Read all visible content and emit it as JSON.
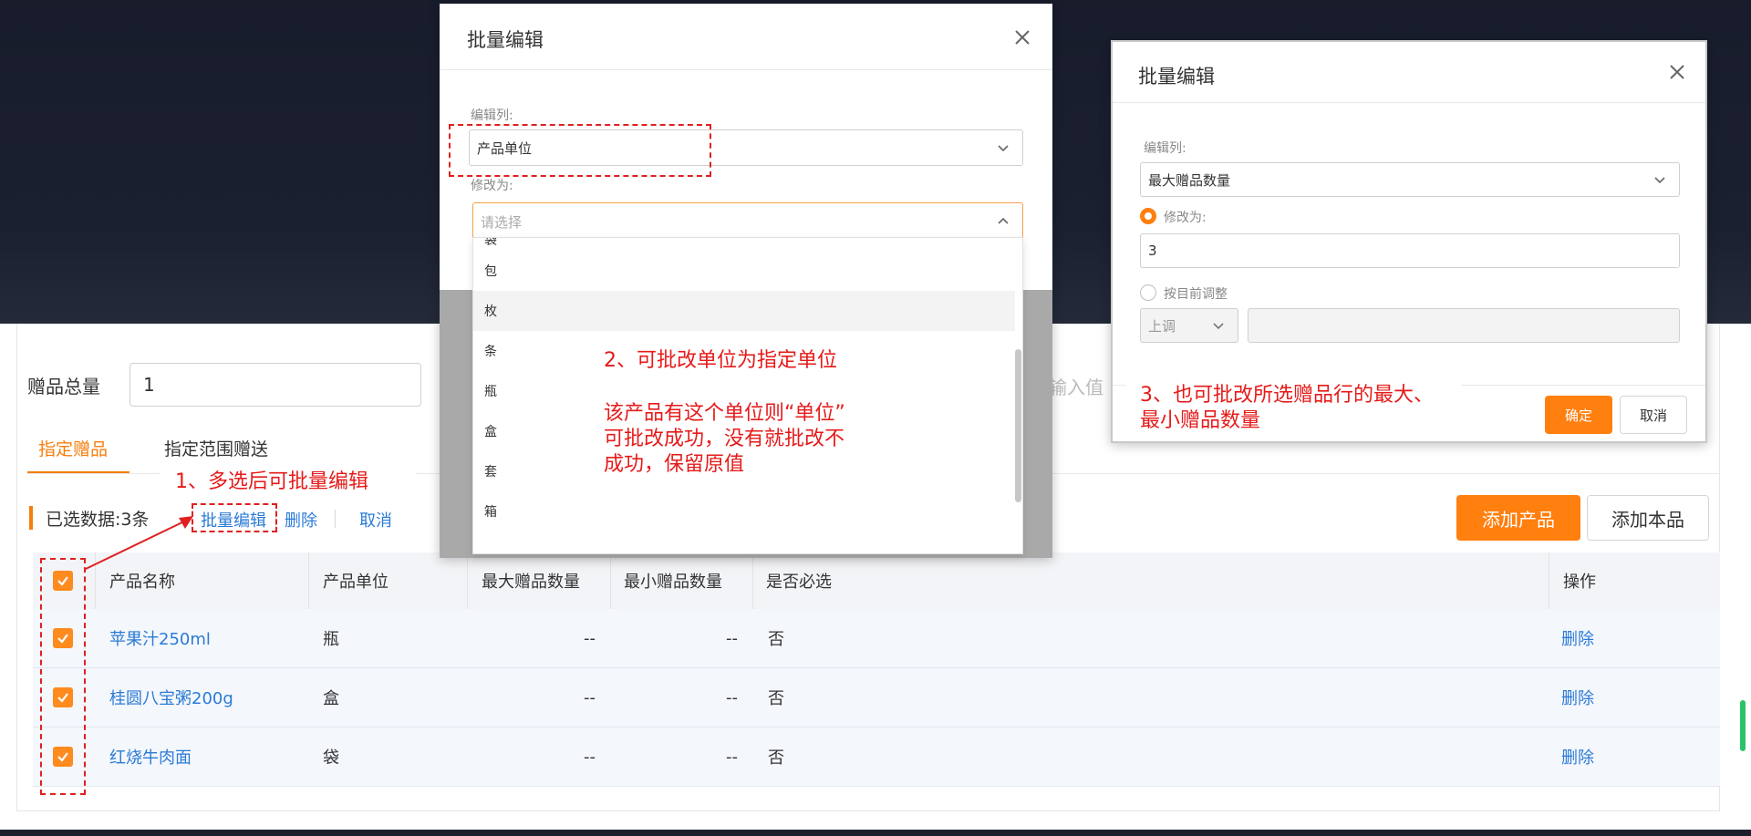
{
  "form": {
    "total_label": "赠品总量",
    "total_value": "1",
    "input_placeholder_fragment": "输入值"
  },
  "tabs": [
    {
      "label": "指定赠品",
      "active": true
    },
    {
      "label": "指定范围赠送",
      "active": false
    }
  ],
  "selection_bar": {
    "selected_text": "已选数据:3条",
    "batch_edit": "批量编辑",
    "delete": "删除",
    "cancel": "取消"
  },
  "actions": {
    "add_product": "添加产品",
    "add_self": "添加本品"
  },
  "table": {
    "headers": [
      "产品名称",
      "产品单位",
      "最大赠品数量",
      "最小赠品数量",
      "是否必选",
      "操作"
    ],
    "rows": [
      {
        "name": "苹果汁250ml",
        "unit": "瓶",
        "max": "--",
        "min": "--",
        "required": "否",
        "op": "删除",
        "checked": true
      },
      {
        "name": "桂圆八宝粥200g",
        "unit": "盒",
        "max": "--",
        "min": "--",
        "required": "否",
        "op": "删除",
        "checked": true
      },
      {
        "name": "红烧牛肉面",
        "unit": "袋",
        "max": "--",
        "min": "--",
        "required": "否",
        "op": "删除",
        "checked": true
      }
    ]
  },
  "modal1": {
    "title": "批量编辑",
    "edit_col_label": "编辑列:",
    "edit_col_value": "产品单位",
    "change_to_label": "修改为:",
    "placeholder": "请选择",
    "options_partial": "袋",
    "options": [
      "包",
      "枚",
      "条",
      "瓶",
      "盒",
      "套",
      "箱"
    ]
  },
  "modal2": {
    "title": "批量编辑",
    "edit_col_label": "编辑列:",
    "edit_col_value": "最大赠品数量",
    "change_to_label": "修改为:",
    "change_to_value": "3",
    "adjust_label": "按目前调整",
    "adjust_select": "上调",
    "confirm": "确定",
    "cancel": "取消"
  },
  "annotations": {
    "a1": "1、多选后可批量编辑",
    "a2_title": "2、可批改单位为指定单位",
    "a2_l1": "该产品有这个单位则“单位”",
    "a2_l2": "可批改成功，没有就批改不",
    "a2_l3": "成功，保留原值",
    "a3_l1": "3、也可批改所选赠品行的最大、",
    "a3_l2": "最小赠品数量"
  },
  "colors": {
    "accent": "#f57e0c",
    "link": "#2b7bd6",
    "annotation": "#e61a1a"
  }
}
